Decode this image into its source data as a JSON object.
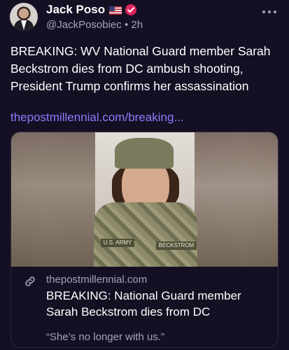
{
  "post": {
    "author_name": "Jack Poso",
    "handle": "@JackPosobiec",
    "separator": "•",
    "time": "2h",
    "text": "BREAKING: WV National Guard member Sarah Beckstrom dies from DC ambush shooting, President Trump confirms her assassination",
    "link": "thepostmillennial.com/breaking...",
    "icons": [
      "us-flag-icon",
      "verified-badge-icon",
      "more-options-icon"
    ]
  },
  "card": {
    "domain": "thepostmillennial.com",
    "title": "BREAKING: National Guard member Sarah Beckstrom dies from DC",
    "description": "“She’s no longer with us.”",
    "image_tapes": {
      "left": "U.S. ARMY",
      "right": "BECKSTROM"
    },
    "icon": "link-icon"
  },
  "colors": {
    "background": "#150f24",
    "link": "#8c7cff",
    "muted": "#a7a3b5",
    "verified": "#e0245e"
  }
}
